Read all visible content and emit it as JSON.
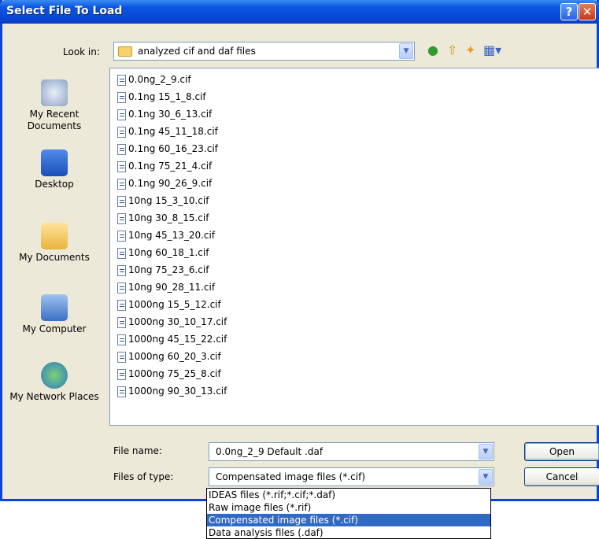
{
  "dialog": {
    "title": "Select File To Load",
    "help_label": "?",
    "close_label": "✕"
  },
  "lookin": {
    "label": "Look in:",
    "value": "analyzed cif and daf files"
  },
  "places": [
    {
      "label": "My Recent Documents",
      "icon": "recent-documents-icon"
    },
    {
      "label": "Desktop",
      "icon": "desktop-icon"
    },
    {
      "label": "My Documents",
      "icon": "my-documents-icon"
    },
    {
      "label": "My Computer",
      "icon": "my-computer-icon"
    },
    {
      "label": "My Network Places",
      "icon": "network-places-icon"
    }
  ],
  "files": [
    "0.0ng_2_9.cif",
    "0.1ng 15_1_8.cif",
    "0.1ng 30_6_13.cif",
    "0.1ng 45_11_18.cif",
    "0.1ng 60_16_23.cif",
    "0.1ng 75_21_4.cif",
    "0.1ng 90_26_9.cif",
    "10ng 15_3_10.cif",
    "10ng 30_8_15.cif",
    "10ng 45_13_20.cif",
    "10ng 60_18_1.cif",
    "10ng 75_23_6.cif",
    "10ng 90_28_11.cif",
    "1000ng 15_5_12.cif",
    "1000ng 30_10_17.cif",
    "1000ng 45_15_22.cif",
    "1000ng 60_20_3.cif",
    "1000ng 75_25_8.cif",
    "1000ng 90_30_13.cif"
  ],
  "filename": {
    "label": "File name:",
    "value": "0.0ng_2_9 Default .daf"
  },
  "filetype": {
    "label": "Files of type:",
    "value": "Compensated image files (*.cif)",
    "options": [
      "IDEAS files (*.rif;*.cif;*.daf)",
      "Raw image files (*.rif)",
      "Compensated image files (*.cif)",
      "Data analysis files (.daf)"
    ]
  },
  "buttons": {
    "open": "Open",
    "cancel": "Cancel"
  },
  "colors": {
    "title_bar": "#0848d8",
    "selection": "#316ac5",
    "dialog_bg": "#ece9d8"
  }
}
